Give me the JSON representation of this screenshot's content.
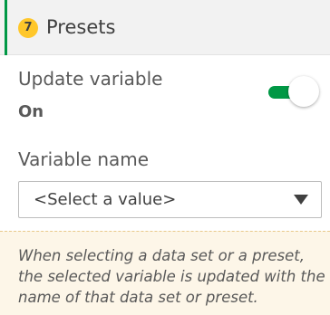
{
  "header": {
    "step_number": "7",
    "title": "Presets",
    "accent_color": "#009845",
    "badge_color": "#ffc72a"
  },
  "update_variable": {
    "label": "Update variable",
    "state_text": "On",
    "enabled": true,
    "toggle_color": "#009845"
  },
  "variable_name": {
    "label": "Variable name",
    "selected_value": "<Select a value>",
    "caret_icon": "caret-down-icon"
  },
  "info": {
    "text": "When selecting a data set or a preset, the selected variable is updated with the name of that data set or preset.",
    "background_color": "#fdf6e8"
  }
}
